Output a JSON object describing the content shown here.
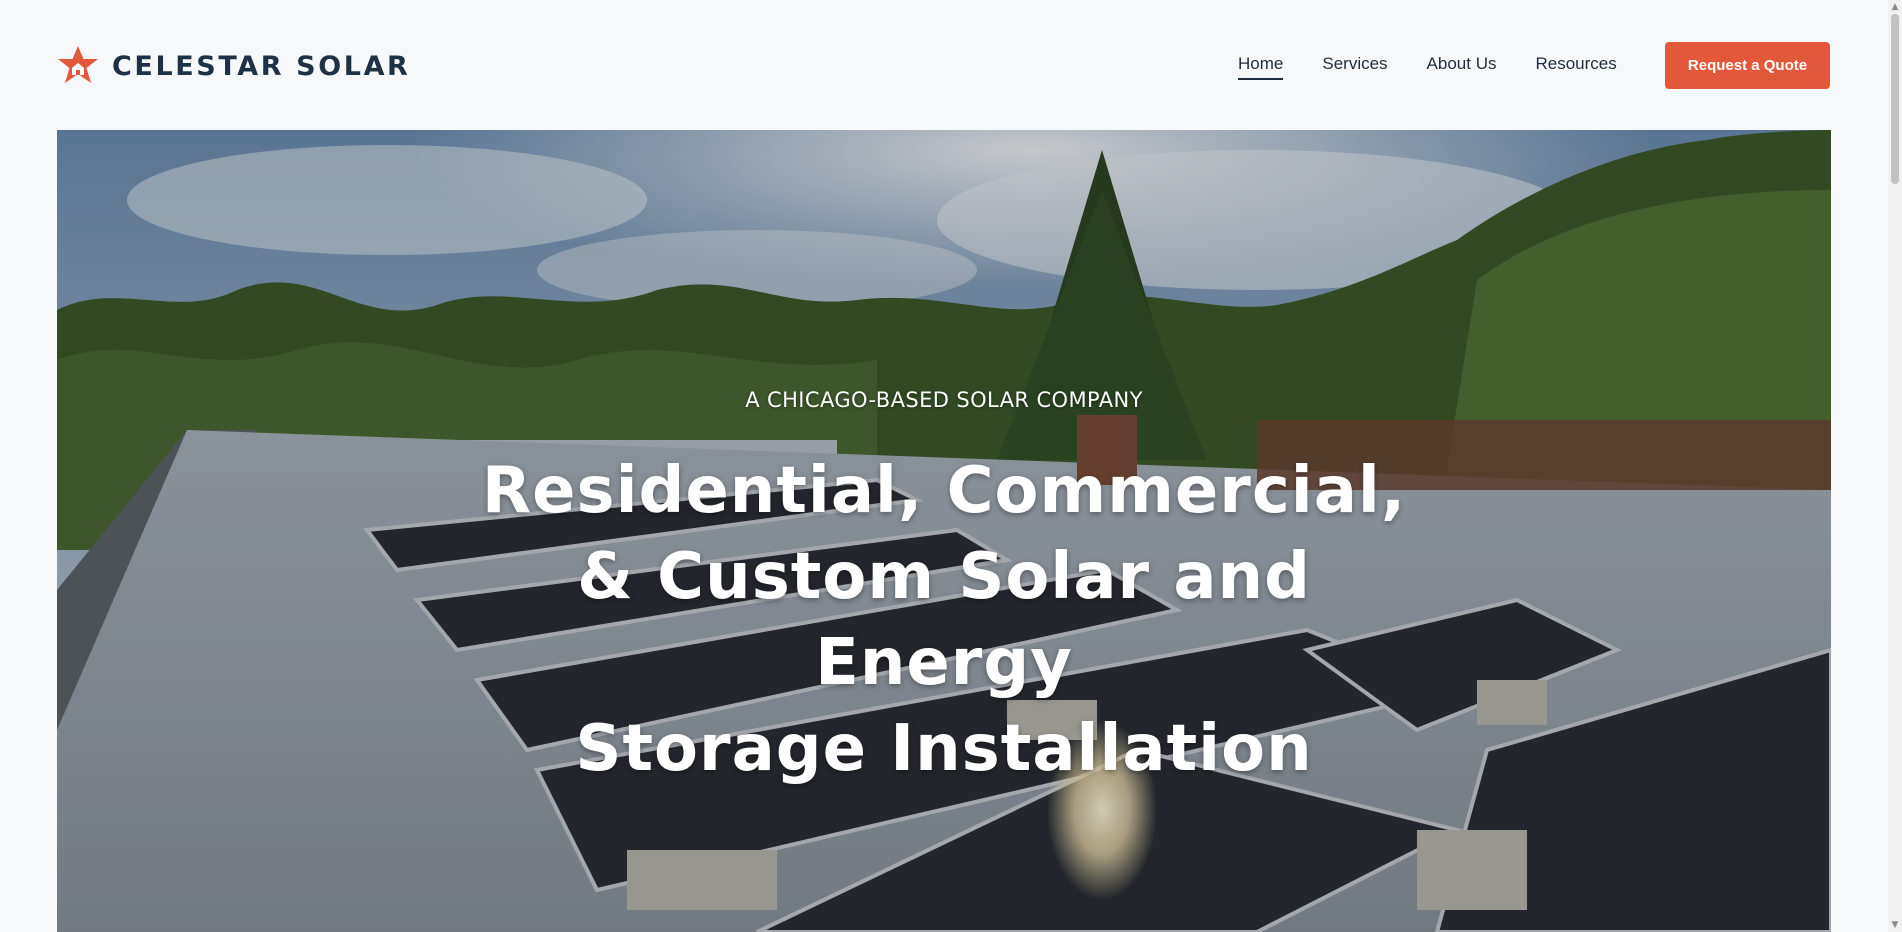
{
  "brand": {
    "name": "CELESTAR SOLAR",
    "logo_icon": "star-house-icon",
    "accent": "#e3583b",
    "text_color": "#1e3145"
  },
  "nav": {
    "items": [
      {
        "label": "Home",
        "active": true
      },
      {
        "label": "Services",
        "active": false
      },
      {
        "label": "About Us",
        "active": false
      },
      {
        "label": "Resources",
        "active": false
      }
    ],
    "cta_label": "Request a Quote"
  },
  "hero": {
    "eyebrow": "A CHICAGO-BASED SOLAR COMPANY",
    "title_lines": [
      "Residential, Commercial,",
      "& Custom Solar and Energy",
      "Storage Installation"
    ]
  }
}
